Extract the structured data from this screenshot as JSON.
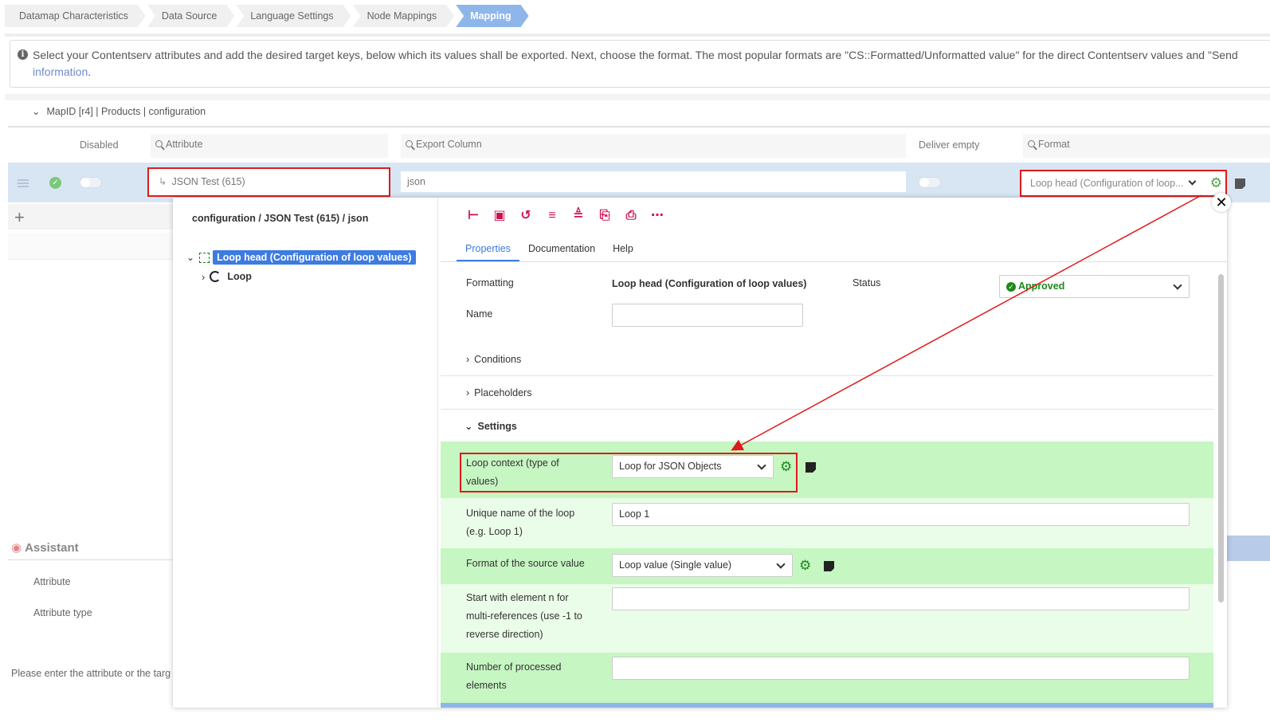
{
  "breadcrumb": [
    "Datamap Characteristics",
    "Data Source",
    "Language Settings",
    "Node Mappings",
    "Mapping"
  ],
  "info": {
    "icon": "info-icon",
    "text": "Select your Contentserv attributes and add the desired target keys, below which its values shall be exported. Next, choose the format. The most popular formats are \"CS::Formatted/Unformatted value\" for the direct Contentserv values and \"Send",
    "link": "information",
    "tail": "."
  },
  "mapid": "MapID [r4] | Products | configuration",
  "columns": {
    "disabled": "Disabled",
    "attribute": "Attribute",
    "export_column": "Export Column",
    "deliver_empty": "Deliver empty",
    "format": "Format"
  },
  "row": {
    "attribute": "JSON Test (615)",
    "export_column": "json",
    "format": "Loop head (Configuration of loop..."
  },
  "assistant": {
    "title": "Assistant",
    "attribute": "Attribute",
    "attribute_type": "Attribute type",
    "hint": "Please enter the attribute or the targ"
  },
  "popup": {
    "tree_title": "configuration / JSON Test (615) / json",
    "tree": {
      "node1": "Loop head (Configuration of loop values)",
      "node2": "Loop"
    },
    "toolbar_icons": [
      "tree-icon",
      "save-icon",
      "undo-icon",
      "export-icon",
      "import-icon",
      "copy-icon",
      "paste-icon",
      "more-icon"
    ],
    "tabs": [
      "Properties",
      "Documentation",
      "Help"
    ],
    "formatting_label": "Formatting",
    "formatting_value": "Loop head (Configuration of loop values)",
    "status_label": "Status",
    "status_value": "Approved",
    "name_label": "Name",
    "name_value": "",
    "conditions": "Conditions",
    "placeholders": "Placeholders",
    "settings": "Settings",
    "loop_context_label": "Loop context (type of values)",
    "loop_context_value": "Loop for JSON Objects",
    "unique_name_label": "Unique name of the loop (e.g. Loop 1)",
    "unique_name_value": "Loop 1",
    "format_source_label": "Format of the source value",
    "format_source_value": "Loop value (Single value)",
    "start_with_label": "Start with element n for multi-references (use -1 to reverse direction)",
    "start_with_value": "",
    "num_processed_label": "Number of processed elements",
    "num_processed_value": ""
  },
  "colors": {
    "accent": "#3d7be0",
    "highlight_red": "#e01a1a",
    "row_green": "#c6f6c2",
    "icon_red": "#d0104d"
  }
}
